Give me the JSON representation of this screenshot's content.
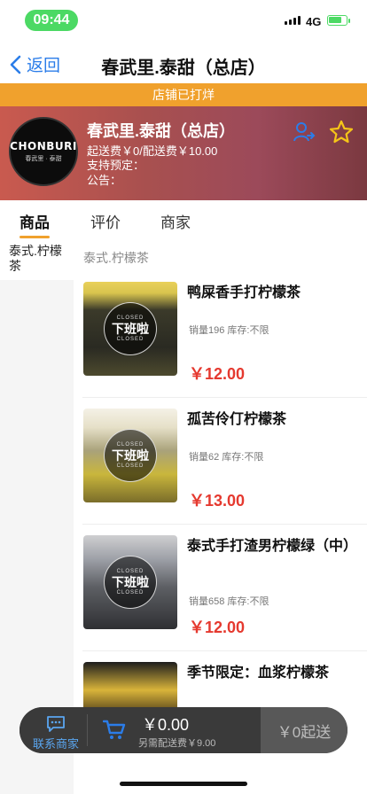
{
  "status_bar": {
    "time": "09:44",
    "network": "4G"
  },
  "nav": {
    "back_label": "返回",
    "title": "春武里.泰甜（总店）"
  },
  "banner": {
    "text": "店铺已打烊"
  },
  "shop": {
    "logo_text": "CHONBURI",
    "logo_sub": "春武里 · 泰甜",
    "name": "春武里.泰甜（总店）",
    "fees": "起送费￥0/配送费￥10.00",
    "preorder": "支持预定：",
    "notice": "公告："
  },
  "tabs": [
    {
      "label": "商品",
      "active": true
    },
    {
      "label": "评价",
      "active": false
    },
    {
      "label": "商家",
      "active": false
    }
  ],
  "sidebar": {
    "items": [
      {
        "label": "泰式.柠檬茶"
      }
    ]
  },
  "category_title": "泰式.柠檬茶",
  "closed_badge": {
    "en": "CLOSED",
    "cn": "下班啦"
  },
  "products": [
    {
      "name": "鸭屎香手打柠檬茶",
      "meta": "销量196 库存:不限",
      "price": "￥12.00"
    },
    {
      "name": "孤苦伶仃柠檬茶",
      "meta": "销量62 库存:不限",
      "price": "￥13.00"
    },
    {
      "name": "泰式手打渣男柠檬绿（中）",
      "meta": "销量658 库存:不限",
      "price": "￥12.00"
    },
    {
      "name": "季节限定：血浆柠檬茶",
      "meta": "",
      "price": ""
    }
  ],
  "cart": {
    "contact_label": "联系商家",
    "total": "￥0.00",
    "delivery_note": "另需配送费￥9.00",
    "checkout_label": "￥0起送"
  },
  "colors": {
    "accent": "#2b7de9",
    "banner": "#f0a12d",
    "price": "#e5392f",
    "favorite": "#f5c518"
  }
}
